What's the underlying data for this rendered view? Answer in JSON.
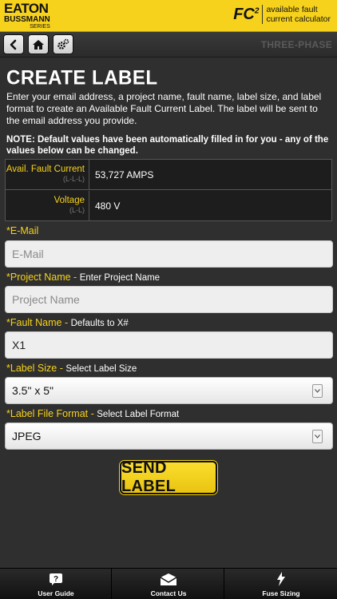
{
  "header": {
    "logo_brand": "EATON",
    "logo_line2": "BUSSMANN",
    "logo_line3": "SERIES",
    "app_mark": "FC",
    "app_mark_sup": "2",
    "app_name_line1": "available fault",
    "app_name_line2": "current calculator"
  },
  "toolbar": {
    "back_icon": "back-arrow-icon",
    "home_icon": "home-icon",
    "settings_icon": "gear-icon",
    "mode_label": "THREE-PHASE"
  },
  "main": {
    "title": "CREATE LABEL",
    "intro": "Enter your email address, a project name, fault name, label size, and label format to create an Available Fault Current Label. The label will be sent to the email address you provide.",
    "note": "NOTE: Default values have been automatically filled in for you - any of the values below can be changed.",
    "info": [
      {
        "label": "Avail. Fault Current",
        "sub": "(L-L-L)",
        "value": "53,727 AMPS"
      },
      {
        "label": "Voltage",
        "sub": "(L-L)",
        "value": "480 V"
      }
    ],
    "email": {
      "label": "*E-Mail",
      "placeholder": "E-Mail",
      "value": ""
    },
    "project": {
      "label": "*Project Name -",
      "hint": "Enter Project Name",
      "placeholder": "Project Name",
      "value": ""
    },
    "fault": {
      "label": "*Fault Name -",
      "hint": "Defaults to X#",
      "value": "X1"
    },
    "label_size": {
      "label": "*Label Size -",
      "hint": "Select Label Size",
      "selected": "3.5\" x 5\""
    },
    "label_format": {
      "label": "*Label File Format -",
      "hint": "Select Label Format",
      "selected": "JPEG"
    },
    "send_button": "SEND LABEL"
  },
  "footer": {
    "tabs": [
      {
        "label": "User Guide",
        "icon": "question-icon"
      },
      {
        "label": "Contact Us",
        "icon": "envelope-icon"
      },
      {
        "label": "Fuse Sizing",
        "icon": "lightning-bolt-icon"
      }
    ]
  },
  "colors": {
    "accent": "#f6d21c",
    "background": "#2f2f2f",
    "field": "#eeeeee"
  }
}
